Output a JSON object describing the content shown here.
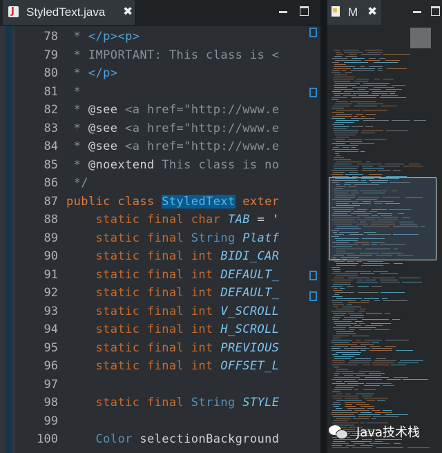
{
  "editor": {
    "tab_title": "StyledText.java",
    "tab_close": "✖",
    "lines": [
      {
        "no": "78",
        "tokens": [
          {
            "c": "cm",
            "t": " * "
          },
          {
            "c": "tag",
            "t": "</p><p>"
          }
        ]
      },
      {
        "no": "79",
        "tokens": [
          {
            "c": "cm",
            "t": " * IMPORTANT: This class is "
          },
          {
            "c": "cm",
            "t": "<"
          }
        ]
      },
      {
        "no": "80",
        "tokens": [
          {
            "c": "cm",
            "t": " * "
          },
          {
            "c": "tag",
            "t": "</p>"
          }
        ]
      },
      {
        "no": "81",
        "tokens": [
          {
            "c": "cm",
            "t": " *"
          }
        ]
      },
      {
        "no": "82",
        "tokens": [
          {
            "c": "cm",
            "t": " * "
          },
          {
            "c": "norm",
            "t": "@see"
          },
          {
            "c": "cm",
            "t": " <a href=\"http://www.e"
          }
        ]
      },
      {
        "no": "83",
        "tokens": [
          {
            "c": "cm",
            "t": " * "
          },
          {
            "c": "norm",
            "t": "@see"
          },
          {
            "c": "cm",
            "t": " <a href=\"http://www.e"
          }
        ]
      },
      {
        "no": "84",
        "tokens": [
          {
            "c": "cm",
            "t": " * "
          },
          {
            "c": "norm",
            "t": "@see"
          },
          {
            "c": "cm",
            "t": " <a href=\"http://www.e"
          }
        ]
      },
      {
        "no": "85",
        "tokens": [
          {
            "c": "cm",
            "t": " * "
          },
          {
            "c": "norm",
            "t": "@noextend"
          },
          {
            "c": "cm",
            "t": " This class is no"
          }
        ]
      },
      {
        "no": "86",
        "tokens": [
          {
            "c": "cm",
            "t": " */"
          }
        ]
      },
      {
        "no": "87",
        "tokens": [
          {
            "c": "kwr",
            "t": "public class "
          },
          {
            "c": "sel",
            "t": "StyledText"
          },
          {
            "c": "kwr",
            "t": " exter"
          }
        ]
      },
      {
        "no": "88",
        "tokens": [
          {
            "c": "kwb",
            "t": "    static final char "
          },
          {
            "c": "fld",
            "t": "TAB"
          },
          {
            "c": "op",
            "t": " = '"
          }
        ]
      },
      {
        "no": "89",
        "tokens": [
          {
            "c": "kwb",
            "t": "    static final "
          },
          {
            "c": "typ",
            "t": "String "
          },
          {
            "c": "fld",
            "t": "Platf"
          }
        ]
      },
      {
        "no": "90",
        "tokens": [
          {
            "c": "kwb",
            "t": "    static final int "
          },
          {
            "c": "fld",
            "t": "BIDI_CAR"
          }
        ]
      },
      {
        "no": "91",
        "tokens": [
          {
            "c": "kwb",
            "t": "    static final int "
          },
          {
            "c": "fld",
            "t": "DEFAULT_"
          }
        ]
      },
      {
        "no": "92",
        "tokens": [
          {
            "c": "kwb",
            "t": "    static final int "
          },
          {
            "c": "fld",
            "t": "DEFAULT_"
          }
        ]
      },
      {
        "no": "93",
        "tokens": [
          {
            "c": "kwb",
            "t": "    static final int "
          },
          {
            "c": "fld",
            "t": "V_SCROLL"
          }
        ]
      },
      {
        "no": "94",
        "tokens": [
          {
            "c": "kwb",
            "t": "    static final int "
          },
          {
            "c": "fld",
            "t": "H_SCROLL"
          }
        ]
      },
      {
        "no": "95",
        "tokens": [
          {
            "c": "kwb",
            "t": "    static final int "
          },
          {
            "c": "fld",
            "t": "PREVIOUS"
          }
        ]
      },
      {
        "no": "96",
        "tokens": [
          {
            "c": "kwb",
            "t": "    static final int "
          },
          {
            "c": "fld",
            "t": "OFFSET_L"
          }
        ]
      },
      {
        "no": "97",
        "tokens": []
      },
      {
        "no": "98",
        "tokens": [
          {
            "c": "kwb",
            "t": "    static final "
          },
          {
            "c": "typ",
            "t": "String "
          },
          {
            "c": "fld",
            "t": "STYLE"
          }
        ]
      },
      {
        "no": "99",
        "tokens": []
      },
      {
        "no": "100",
        "tokens": [
          {
            "c": "typ",
            "t": "    Color "
          },
          {
            "c": "norm",
            "t": "selectionBackground"
          }
        ]
      }
    ]
  },
  "minimap": {
    "tab_label": "M",
    "tab_close": "✖"
  },
  "watermark": {
    "text": "Java技术栈"
  }
}
